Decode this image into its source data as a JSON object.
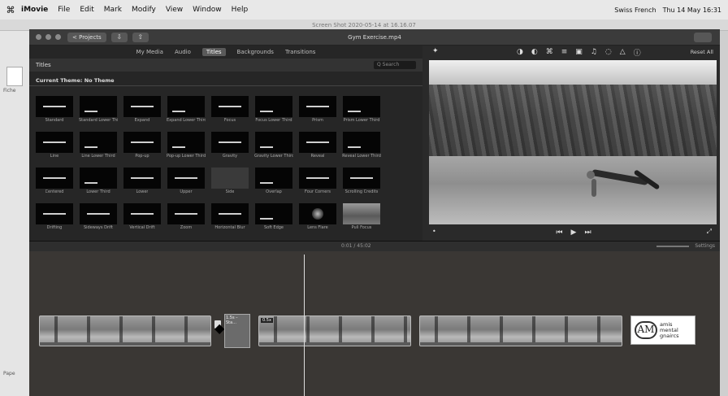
{
  "menubar": {
    "apple": "⌘",
    "items": [
      "iMovie",
      "File",
      "Edit",
      "Mark",
      "Modify",
      "View",
      "Window",
      "Help"
    ],
    "keyboard": "Swiss French",
    "clock": "Thu 14 May 16:31"
  },
  "bg_window": {
    "title": "Screen Shot 2020-05-14 at 16.16.07",
    "side_labels": [
      "Fiche",
      "Pape"
    ]
  },
  "app": {
    "projects_button": "< Projects",
    "title": "Gym Exercise.mp4",
    "tabs": [
      "My Media",
      "Audio",
      "Titles",
      "Backgrounds",
      "Transitions"
    ],
    "active_tab": "Titles",
    "library_title": "Titles",
    "search_placeholder": "Q Search",
    "theme_label": "Current Theme: No Theme",
    "titles": [
      {
        "label": "Standard",
        "style": "mid"
      },
      {
        "label": "Standard Lower Third",
        "style": "low"
      },
      {
        "label": "Expand",
        "style": "mid"
      },
      {
        "label": "Expand Lower Third",
        "style": "low"
      },
      {
        "label": "Focus",
        "style": "mid"
      },
      {
        "label": "Focus Lower Third",
        "style": "low"
      },
      {
        "label": "Prism",
        "style": "mid"
      },
      {
        "label": "Prism Lower Third",
        "style": "low"
      },
      {
        "label": "Line",
        "style": "mid"
      },
      {
        "label": "Line Lower Third",
        "style": "low"
      },
      {
        "label": "Pop-up",
        "style": "mid"
      },
      {
        "label": "Pop-up Lower Third",
        "style": "low"
      },
      {
        "label": "Gravity",
        "style": "mid"
      },
      {
        "label": "Gravity Lower Third",
        "style": "low"
      },
      {
        "label": "Reveal",
        "style": "mid"
      },
      {
        "label": "Reveal Lower Third",
        "style": "low"
      },
      {
        "label": "Centered",
        "style": "mid"
      },
      {
        "label": "Lower Third",
        "style": "low"
      },
      {
        "label": "Lower",
        "style": "mid"
      },
      {
        "label": "Upper",
        "style": "mid"
      },
      {
        "label": "Side",
        "style": "grey"
      },
      {
        "label": "Overlap",
        "style": "low"
      },
      {
        "label": "Four Corners",
        "style": "mid"
      },
      {
        "label": "Scrolling Credits",
        "style": "mid"
      },
      {
        "label": "Drifting",
        "style": "mid"
      },
      {
        "label": "Sideways Drift",
        "style": "mid"
      },
      {
        "label": "Vertical Drift",
        "style": "mid"
      },
      {
        "label": "Zoom",
        "style": "mid"
      },
      {
        "label": "Horizontal Blur",
        "style": "mid"
      },
      {
        "label": "Soft Edge",
        "style": "low"
      },
      {
        "label": "Lens Flare",
        "style": "bokeh"
      },
      {
        "label": "Pull Focus",
        "style": "photo"
      }
    ],
    "viewer_tools": [
      "◑",
      "◐",
      "⌘",
      "≡",
      "▣",
      "♫",
      "◌",
      "△",
      "ⓘ"
    ],
    "wand_icon": "✦",
    "reset_all": "Reset All",
    "playback": {
      "prev": "⏮",
      "play": "▶",
      "next": "⏭"
    },
    "mic_icon": "•",
    "fullscreen_icon": "⤢",
    "timecode": "0:01 / 45:02",
    "settings": "Settings",
    "clip_badge": "0.5x",
    "title_clip_text": "1.5s – Sta...",
    "transition_icon": "◆",
    "logo": {
      "mark": "AM",
      "lines": [
        "amis",
        "mental",
        "gnaircs"
      ]
    }
  }
}
